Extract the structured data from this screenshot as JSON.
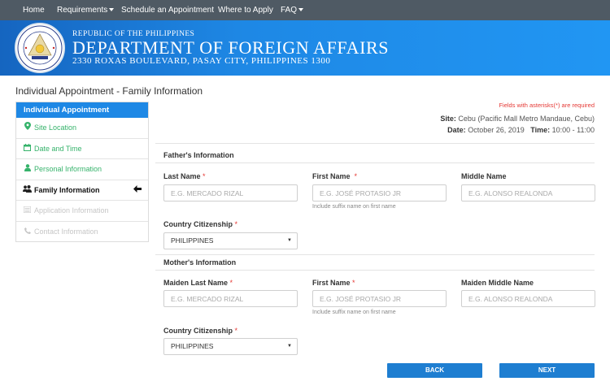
{
  "nav": {
    "home": "Home",
    "requirements": "Requirements",
    "schedule": "Schedule an Appointment",
    "where": "Where to Apply",
    "faq": "FAQ"
  },
  "banner": {
    "republic": "REPUBLIC OF THE PHILIPPINES",
    "department": "DEPARTMENT OF FOREIGN AFFAIRS",
    "address": "2330 ROXAS BOULEVARD, PASAY CITY, PHILIPPINES 1300",
    "seal_text": "DEPARTMENT OF FOREIGN AFFAIRS"
  },
  "page_title": "Individual Appointment - Family Information",
  "sidebar": {
    "header": "Individual Appointment",
    "items": [
      {
        "label": "Site Location",
        "icon": "map-marker-icon",
        "state": "done"
      },
      {
        "label": "Date and Time",
        "icon": "calendar-icon",
        "state": "done"
      },
      {
        "label": "Personal Information",
        "icon": "user-icon",
        "state": "done"
      },
      {
        "label": "Family Information",
        "icon": "users-icon",
        "state": "active"
      },
      {
        "label": "Application Information",
        "icon": "list-icon",
        "state": "disabled"
      },
      {
        "label": "Contact Information",
        "icon": "phone-icon",
        "state": "disabled"
      }
    ]
  },
  "required_note": "Fields with asterisks(*) are required",
  "appointment": {
    "site_label": "Site:",
    "site_value": "Cebu (Pacific Mall Metro Mandaue, Cebu)",
    "date_label": "Date:",
    "date_value": "October 26, 2019",
    "time_label": "Time:",
    "time_value": "10:00 - 11:00"
  },
  "father": {
    "section": "Father's Information",
    "last_name_label": "Last Name",
    "first_name_label": "First Name",
    "middle_name_label": "Middle Name",
    "last_name_placeholder": "E.G. MERCADO RIZAL",
    "first_name_placeholder": "E.G. JOSÉ PROTASIO JR",
    "middle_name_placeholder": "E.G. ALONSO REALONDA",
    "suffix_hint": "Include suffix name on first name",
    "citizenship_label": "Country Citizenship",
    "citizenship_value": "PHILIPPINES"
  },
  "mother": {
    "section": "Mother's Information",
    "last_name_label": "Maiden Last Name",
    "first_name_label": "First Name",
    "middle_name_label": "Maiden Middle Name",
    "last_name_placeholder": "E.G. MERCADO RIZAL",
    "first_name_placeholder": "E.G. JOSÉ PROTASIO JR",
    "middle_name_placeholder": "E.G. ALONSO REALONDA",
    "suffix_hint": "Include suffix name on first name",
    "citizenship_label": "Country Citizenship",
    "citizenship_value": "PHILIPPINES"
  },
  "required_mark": "*",
  "buttons": {
    "back": "BACK",
    "next": "NEXT"
  },
  "colors": {
    "nav_bg": "#4f5a64",
    "brand_blue": "#1e88e5",
    "done_green": "#36b36b",
    "required_red": "#e53935"
  }
}
